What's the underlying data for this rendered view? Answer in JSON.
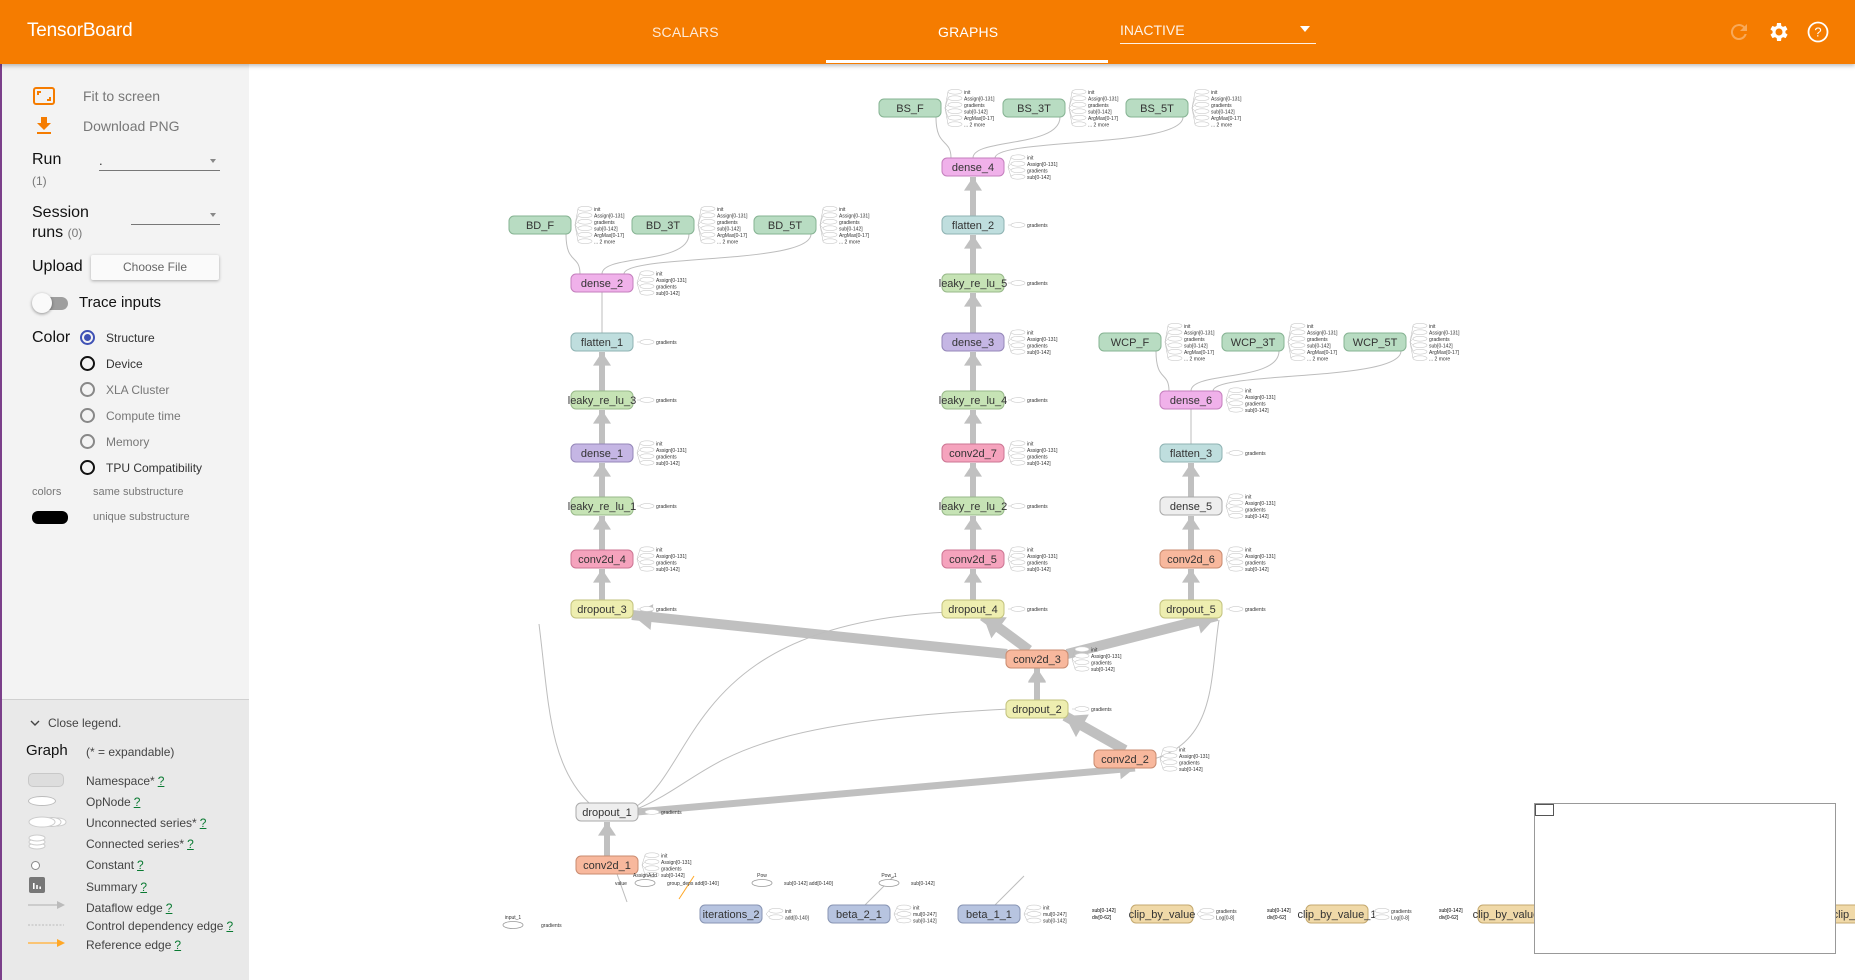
{
  "header": {
    "title": "TensorBoard",
    "tabs": [
      {
        "label": "SCALARS",
        "active": false
      },
      {
        "label": "GRAPHS",
        "active": true
      }
    ],
    "inactive_select": "INACTIVE",
    "icons": [
      "refresh-icon",
      "settings-icon",
      "help-icon"
    ]
  },
  "sidebar": {
    "fit_to_screen": "Fit to screen",
    "download_png": "Download PNG",
    "run_label": "Run",
    "run_count": "(1)",
    "run_value": ".",
    "session_label_1": "Session",
    "session_label_2": "runs",
    "session_count": "(0)",
    "session_value": "",
    "upload_label": "Upload",
    "choose_file": "Choose File",
    "trace_inputs": "Trace inputs",
    "trace_inputs_on": false,
    "color_label": "Color",
    "color_options": [
      {
        "label": "Structure",
        "checked": true,
        "enabled": true
      },
      {
        "label": "Device",
        "checked": false,
        "enabled": true
      },
      {
        "label": "XLA Cluster",
        "checked": false,
        "enabled": false
      },
      {
        "label": "Compute time",
        "checked": false,
        "enabled": false
      },
      {
        "label": "Memory",
        "checked": false,
        "enabled": false
      },
      {
        "label": "TPU Compatibility",
        "checked": false,
        "enabled": true
      }
    ],
    "colors_label": "colors",
    "same_substructure": "same substructure",
    "unique_substructure": "unique substructure"
  },
  "legend": {
    "close_legend": "Close legend.",
    "graph_label": "Graph",
    "expandable_note": "(* = expandable)",
    "items": [
      {
        "label": "Namespace*",
        "help": "?",
        "icon": "namespace-icon"
      },
      {
        "label": "OpNode",
        "help": "?",
        "icon": "opnode-icon"
      },
      {
        "label": "Unconnected series*",
        "help": "?",
        "icon": "unconnected-series-icon"
      },
      {
        "label": "Connected series*",
        "help": "?",
        "icon": "connected-series-icon"
      },
      {
        "label": "Constant",
        "help": "?",
        "icon": "constant-icon"
      },
      {
        "label": "Summary",
        "help": "?",
        "icon": "summary-icon"
      },
      {
        "label": "Dataflow edge",
        "help": "?",
        "icon": "dataflow-edge-icon"
      },
      {
        "label": "Control dependency edge",
        "help": "?",
        "icon": "control-edge-icon"
      },
      {
        "label": "Reference edge",
        "help": "?",
        "icon": "reference-edge-icon"
      }
    ]
  },
  "colors": {
    "header": "#f57c00",
    "green": "#b8dcc2",
    "pink": "#f0b1ea",
    "teal": "#bfdede",
    "lightgreen": "#c6e3b5",
    "purple": "#c5b6e4",
    "red": "#f5a3bd",
    "yellow": "#eeeeb0",
    "salmon": "#f8b89d",
    "gray": "#eeeeee",
    "blue": "#b7c4e0",
    "tan": "#f0d9a8"
  },
  "graph": {
    "nodes": [
      {
        "id": "BS_F",
        "label": "BS_F",
        "color": "green",
        "aux": [
          "init",
          "Assign[0-131]",
          "gradients",
          "sub[0-142]",
          "ArgMax[0-17]",
          "... 2 more"
        ]
      },
      {
        "id": "BS_3T",
        "label": "BS_3T",
        "color": "green",
        "aux": [
          "init",
          "Assign[0-131]",
          "gradients",
          "sub[0-142]",
          "ArgMax[0-17]",
          "... 2 more"
        ]
      },
      {
        "id": "BS_5T",
        "label": "BS_5T",
        "color": "green",
        "aux": [
          "init",
          "Assign[0-131]",
          "gradients",
          "sub[0-142]",
          "ArgMax[0-17]",
          "... 2 more"
        ]
      },
      {
        "id": "dense_4",
        "label": "dense_4",
        "color": "pink",
        "aux": [
          "init",
          "Assign[0-131]",
          "gradients",
          "sub[0-142]"
        ]
      },
      {
        "id": "flatten_2",
        "label": "flatten_2",
        "color": "teal",
        "aux": [
          "gradients"
        ]
      },
      {
        "id": "leaky_re_lu_5",
        "label": "leaky_re_lu_5",
        "color": "lightgreen",
        "aux": [
          "gradients"
        ]
      },
      {
        "id": "dense_3",
        "label": "dense_3",
        "color": "purple",
        "aux": [
          "init",
          "Assign[0-131]",
          "gradients",
          "sub[0-142]"
        ]
      },
      {
        "id": "leaky_re_lu_4",
        "label": "leaky_re_lu_4",
        "color": "lightgreen",
        "aux": [
          "gradients"
        ]
      },
      {
        "id": "conv2d_7",
        "label": "conv2d_7",
        "color": "red",
        "aux": [
          "init",
          "Assign[0-131]",
          "gradients",
          "sub[0-142]"
        ]
      },
      {
        "id": "leaky_re_lu_2",
        "label": "leaky_re_lu_2",
        "color": "lightgreen",
        "aux": [
          "gradients"
        ]
      },
      {
        "id": "conv2d_5",
        "label": "conv2d_5",
        "color": "red",
        "aux": [
          "init",
          "Assign[0-131]",
          "gradients",
          "sub[0-142]"
        ]
      },
      {
        "id": "dropout_4",
        "label": "dropout_4",
        "color": "yellow",
        "aux": [
          "gradients"
        ]
      },
      {
        "id": "BD_F",
        "label": "BD_F",
        "color": "green",
        "aux": [
          "init",
          "Assign[0-131]",
          "gradients",
          "sub[0-142]",
          "ArgMax[0-17]",
          "... 2 more"
        ]
      },
      {
        "id": "BD_3T",
        "label": "BD_3T",
        "color": "green",
        "aux": [
          "init",
          "Assign[0-131]",
          "gradients",
          "sub[0-142]",
          "ArgMax[0-17]",
          "... 2 more"
        ]
      },
      {
        "id": "BD_5T",
        "label": "BD_5T",
        "color": "green",
        "aux": [
          "init",
          "Assign[0-131]",
          "gradients",
          "sub[0-142]",
          "ArgMax[0-17]",
          "... 2 more"
        ]
      },
      {
        "id": "dense_2",
        "label": "dense_2",
        "color": "pink",
        "aux": [
          "init",
          "Assign[0-131]",
          "gradients",
          "sub[0-142]"
        ]
      },
      {
        "id": "flatten_1",
        "label": "flatten_1",
        "color": "teal",
        "aux": [
          "gradients"
        ]
      },
      {
        "id": "leaky_re_lu_3",
        "label": "leaky_re_lu_3",
        "color": "lightgreen",
        "aux": [
          "gradients"
        ]
      },
      {
        "id": "dense_1",
        "label": "dense_1",
        "color": "purple",
        "aux": [
          "init",
          "Assign[0-131]",
          "gradients",
          "sub[0-142]"
        ]
      },
      {
        "id": "leaky_re_lu_1",
        "label": "leaky_re_lu_1",
        "color": "lightgreen",
        "aux": [
          "gradients"
        ]
      },
      {
        "id": "conv2d_4",
        "label": "conv2d_4",
        "color": "red",
        "aux": [
          "init",
          "Assign[0-131]",
          "gradients",
          "sub[0-142]"
        ]
      },
      {
        "id": "dropout_3",
        "label": "dropout_3",
        "color": "yellow",
        "aux": [
          "gradients"
        ]
      },
      {
        "id": "WCP_F",
        "label": "WCP_F",
        "color": "green",
        "aux": [
          "init",
          "Assign[0-131]",
          "gradients",
          "sub[0-142]",
          "ArgMax[0-17]",
          "... 2 more"
        ]
      },
      {
        "id": "WCP_3T",
        "label": "WCP_3T",
        "color": "green",
        "aux": [
          "init",
          "Assign[0-131]",
          "gradients",
          "sub[0-142]",
          "ArgMax[0-17]",
          "... 2 more"
        ]
      },
      {
        "id": "WCP_5T",
        "label": "WCP_5T",
        "color": "green",
        "aux": [
          "init",
          "Assign[0-131]",
          "gradients",
          "sub[0-142]",
          "ArgMax[0-17]",
          "... 2 more"
        ]
      },
      {
        "id": "dense_6",
        "label": "dense_6",
        "color": "pink",
        "aux": [
          "init",
          "Assign[0-131]",
          "gradients",
          "sub[0-142]"
        ]
      },
      {
        "id": "flatten_3",
        "label": "flatten_3",
        "color": "teal",
        "aux": [
          "gradients"
        ]
      },
      {
        "id": "dense_5",
        "label": "dense_5",
        "color": "gray",
        "aux": [
          "init",
          "Assign[0-131]",
          "gradients",
          "sub[0-142]"
        ]
      },
      {
        "id": "conv2d_6",
        "label": "conv2d_6",
        "color": "salmon",
        "aux": [
          "init",
          "Assign[0-131]",
          "gradients",
          "sub[0-142]"
        ]
      },
      {
        "id": "dropout_5",
        "label": "dropout_5",
        "color": "yellow",
        "aux": [
          "gradients"
        ]
      },
      {
        "id": "conv2d_3",
        "label": "conv2d_3",
        "color": "salmon",
        "aux": [
          "init",
          "Assign[0-131]",
          "gradients",
          "sub[0-142]"
        ]
      },
      {
        "id": "dropout_2",
        "label": "dropout_2",
        "color": "yellow",
        "aux": [
          "gradients"
        ]
      },
      {
        "id": "conv2d_2",
        "label": "conv2d_2",
        "color": "salmon",
        "aux": [
          "init",
          "Assign[0-131]",
          "gradients",
          "sub[0-142]"
        ]
      },
      {
        "id": "dropout_1",
        "label": "dropout_1",
        "color": "gray",
        "aux": [
          "gradients"
        ]
      },
      {
        "id": "conv2d_1",
        "label": "conv2d_1",
        "color": "salmon",
        "aux": [
          "init",
          "Assign[0-131]",
          "gradients",
          "sub[0-142]"
        ]
      },
      {
        "id": "iterations_2",
        "label": "iterations_2",
        "color": "blue",
        "aux": [
          "init",
          "add[0-140]"
        ]
      },
      {
        "id": "beta_2_1",
        "label": "beta_2_1",
        "color": "blue",
        "aux": [
          "init",
          "mul[0-247]",
          "sub[0-142]"
        ]
      },
      {
        "id": "beta_1_1",
        "label": "beta_1_1",
        "color": "blue",
        "aux": [
          "init",
          "mul[0-247]",
          "sub[0-142]"
        ]
      },
      {
        "id": "clip_by_value",
        "label": "clip_by_value",
        "color": "tan",
        "aux": [
          "gradients",
          "Log[0-8]"
        ]
      },
      {
        "id": "clip_by_value_1",
        "label": "clip_by_value_1",
        "color": "tan",
        "aux": [
          "gradients",
          "Log[0-8]"
        ]
      },
      {
        "id": "clip_by_value_2",
        "label": "clip_by_value_",
        "color": "tan",
        "aux": []
      },
      {
        "id": "clip_by_value_3",
        "label": "clip_b",
        "color": "tan",
        "aux": []
      }
    ],
    "ops": [
      {
        "id": "input_1",
        "label": "input_1",
        "aux": [
          "gradients"
        ]
      },
      {
        "id": "AssignAdd",
        "label": "AssignAdd",
        "left": "value",
        "right": "group_deps  add[0-140]"
      },
      {
        "id": "Pow",
        "label": "Pow",
        "right": "sub[0-142]  add[0-140]"
      },
      {
        "id": "Pow_1",
        "label": "Pow_1",
        "right": "sub[0-142]"
      }
    ],
    "clip_inputs": [
      "sub[0-142]",
      "div[0-62]"
    ]
  }
}
